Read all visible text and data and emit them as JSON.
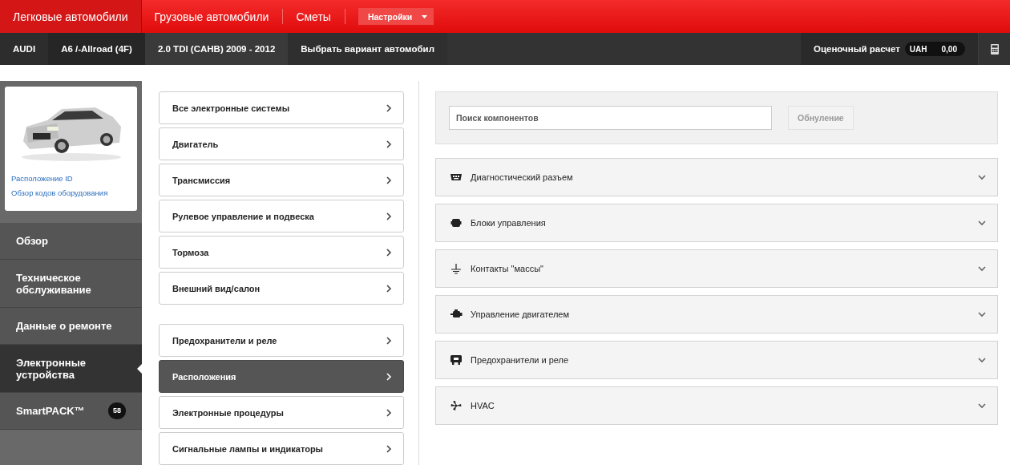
{
  "top_tabs": [
    {
      "label": "Легковые автомобили",
      "selected": true
    },
    {
      "label": "Грузовые автомобили",
      "selected": false
    },
    {
      "label": "Сметы",
      "selected": false
    }
  ],
  "settings_dropdown": {
    "label": "Настройки"
  },
  "breadcrumb": [
    "AUDI",
    "A6 /-Allroad (4F)",
    "2.0 TDI (CAHB) 2009 - 2012",
    "Выбрать вариант автомобил"
  ],
  "estimate": {
    "label": "Оценочный расчет",
    "currency": "UAH",
    "amount": "0,00"
  },
  "vehicle_card": {
    "links": [
      "Расположение ID",
      "Обзор кодов оборудования"
    ]
  },
  "sidebar": {
    "items": [
      {
        "label": "Обзор",
        "selected": false
      },
      {
        "label": "Техническое обслуживание",
        "selected": false
      },
      {
        "label": "Данные о ремонте",
        "selected": false
      },
      {
        "label": "Электронные устройства",
        "selected": true
      },
      {
        "label": "SmartPACK™",
        "selected": false,
        "badge": "58"
      }
    ]
  },
  "menu_groups": [
    [
      {
        "label": "Все электронные системы",
        "selected": false
      },
      {
        "label": "Двигатель",
        "selected": false
      },
      {
        "label": "Трансмиссия",
        "selected": false
      },
      {
        "label": "Рулевое управление и подвеска",
        "selected": false
      },
      {
        "label": "Тормоза",
        "selected": false
      },
      {
        "label": "Внешний вид/салон",
        "selected": false
      }
    ],
    [
      {
        "label": "Предохранители и реле",
        "selected": false
      },
      {
        "label": "Расположения",
        "selected": true
      },
      {
        "label": "Электронные процедуры",
        "selected": false
      },
      {
        "label": "Сигнальные лампы и индикаторы",
        "selected": false
      }
    ]
  ],
  "search": {
    "placeholder": "Поиск компонентов",
    "reset_button": {
      "label": "Обнуление",
      "disabled": true
    }
  },
  "components": [
    {
      "label": "Диагностический разъем",
      "kind": "connector",
      "expanded": false
    },
    {
      "label": "Блоки управления",
      "kind": "module",
      "expanded": false
    },
    {
      "label": "Контакты \"массы\"",
      "kind": "ground",
      "expanded": false
    },
    {
      "label": "Управление двигателем",
      "kind": "engine",
      "expanded": false
    },
    {
      "label": "Предохранители и реле",
      "kind": "fuse",
      "expanded": false
    },
    {
      "label": "HVAC",
      "kind": "fan",
      "expanded": false
    }
  ]
}
